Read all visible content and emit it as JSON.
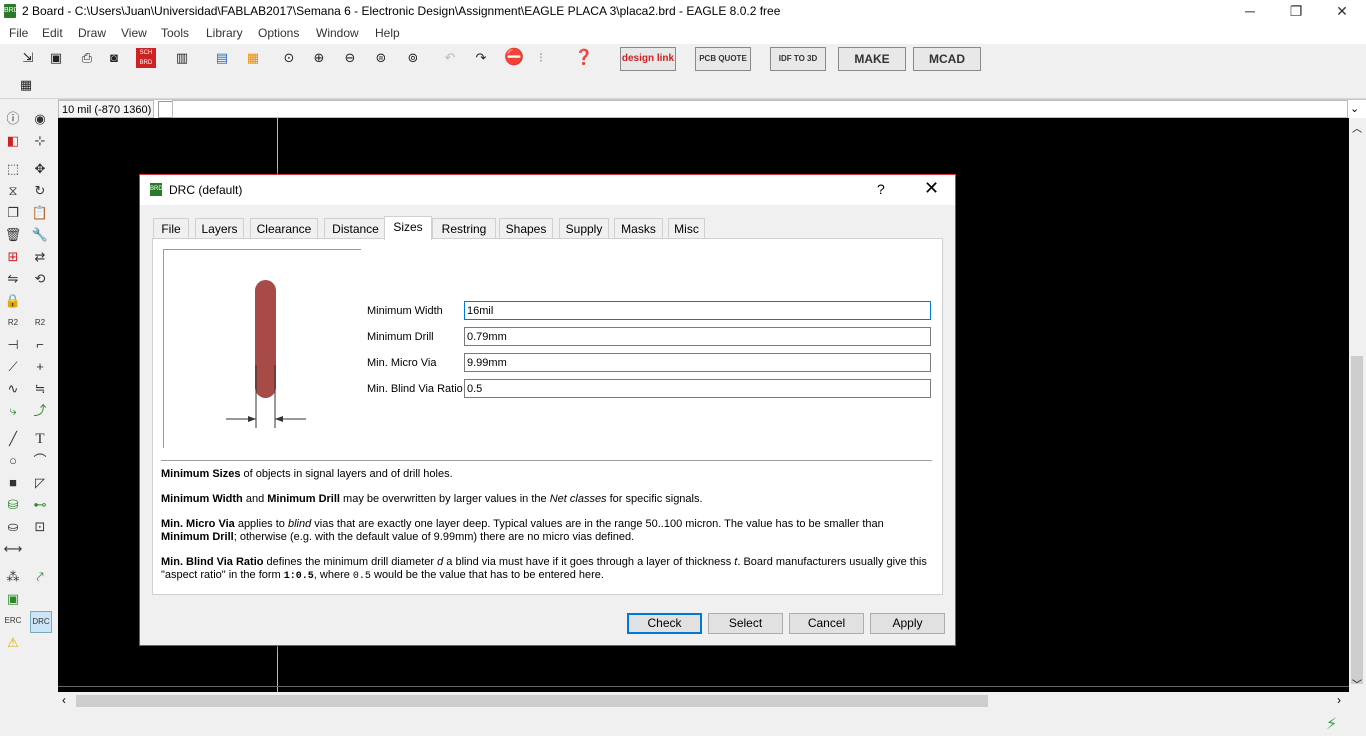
{
  "window": {
    "title": "2 Board - C:\\Users\\Juan\\Universidad\\FABLAB2017\\Semana 6 - Electronic Design\\Assignment\\EAGLE PLACA 3\\placa2.brd - EAGLE 8.0.2 free",
    "app_icon_text": "BRD",
    "minimize": "─",
    "restore": "❐",
    "close": "✕"
  },
  "menu": [
    "File",
    "Edit",
    "Draw",
    "View",
    "Tools",
    "Library",
    "Options",
    "Window",
    "Help"
  ],
  "toolbar": {
    "sch_brd": "SCH BRD",
    "design_link": "design link",
    "pcb_quote": "PCB QUOTE",
    "idf": "IDF TO 3D",
    "make": "MAKE",
    "mcad": "MCAD"
  },
  "commandline": {
    "coord": "10 mil (-870 1360)"
  },
  "toolbox": {
    "erc": "ERC",
    "drc": "DRC"
  },
  "dialog": {
    "title": "DRC (default)",
    "help": "?",
    "close": "✕",
    "tabs": [
      "File",
      "Layers",
      "Clearance",
      "Distance",
      "Sizes",
      "Restring",
      "Shapes",
      "Supply",
      "Masks",
      "Misc"
    ],
    "active_tab": "Sizes",
    "fields": [
      {
        "label": "Minimum Width",
        "value": "16mil"
      },
      {
        "label": "Minimum Drill",
        "value": "0.79mm"
      },
      {
        "label": "Min. Micro Via",
        "value": "9.99mm"
      },
      {
        "label": "Min. Blind Via Ratio",
        "value": "0.5"
      }
    ],
    "help_text": {
      "p1_b1": "Minimum Sizes",
      "p1_t1": " of objects in signal layers and of drill holes.",
      "p2_b1": "Minimum Width",
      "p2_t1": " and ",
      "p2_b2": "Minimum Drill",
      "p2_t2": " may be overwritten by larger values in the ",
      "p2_i1": "Net classes",
      "p2_t3": " for specific signals.",
      "p3_b1": "Min. Micro Via",
      "p3_t1": " applies to ",
      "p3_i1": "blind",
      "p3_t2": " vias that are exactly one layer deep. Typical values are in the range 50..100 micron. The value has to be smaller than",
      "p3_b2": "Minimum Drill",
      "p3_t3": "; otherwise (e.g. with the default value of 9.99mm) there are no micro vias defined.",
      "p4_b1": "Min. Blind Via Ratio",
      "p4_t1": " defines the minimum drill diameter ",
      "p4_i1": "d",
      "p4_t2": " a blind via must have if it goes through a layer of thickness ",
      "p4_i2": "t",
      "p4_t3": ". Board manufacturers usually give this",
      "p4_t4": "\"aspect ratio\" in the form ",
      "p4_m1": "1:0.5",
      "p4_t5": ", where ",
      "p4_m2": "0.5",
      "p4_t6": " would be the value that has to be entered here."
    },
    "buttons": {
      "check": "Check",
      "select": "Select",
      "cancel": "Cancel",
      "apply": "Apply"
    }
  },
  "colors": {
    "canvas": "#000000",
    "dialog_border": "#d9343a",
    "trace": "#a84a46",
    "focus": "#0078d7"
  }
}
